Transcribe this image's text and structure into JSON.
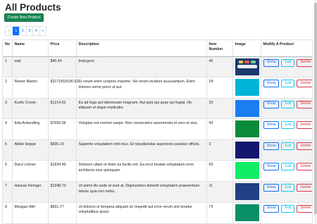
{
  "page": {
    "title": "All Products",
    "create_button": "Create New Product"
  },
  "pagination": {
    "prev": "«",
    "pages": [
      "1",
      "2",
      "3",
      "4"
    ],
    "active_page": "1",
    "next": "»"
  },
  "table": {
    "headers": [
      "No",
      "Name",
      "Price",
      "Description",
      "Item Number",
      "Image",
      "Modify A Product"
    ],
    "actions": {
      "show": "Show",
      "edit": "Edit",
      "delete": "Delete"
    },
    "rows": [
      {
        "no": "1",
        "name": "wali",
        "price": "$40.49",
        "description": "bndcgxvn",
        "item_number": "45",
        "image_color": "#1a3a6e"
      },
      {
        "no": "2",
        "name": "Renee Barton",
        "price": "$3171818196.53",
        "description": "Et rerum enim corporis maxime. Vel rerum incidunt accusantium. Enim dolores nemo porro ut aut.",
        "item_number": "24",
        "image_color": "#00b4d8"
      },
      {
        "no": "3",
        "name": "Kurtis Cronin",
        "price": "$1214.62",
        "description": "Ea ad fuga aut laboriosam magnam. Aut quia qui quae qui fugiat. Hic aliquam ut atque explicabo.",
        "item_number": "33",
        "image_color": "#1a7df0"
      },
      {
        "no": "4",
        "name": "Eda Ankunding",
        "price": "$7693.36",
        "description": "Voluptas est eveniet saepe. Non consectetur assumenda et vero et eius.",
        "item_number": "43",
        "image_color": "#0b8a3a"
      },
      {
        "no": "5",
        "name": "Abbie Hoppe",
        "price": "$835.19",
        "description": "Sapiente voluptatem nihil eius. Et repudiandae asperiores pariatur officiis.",
        "item_number": "2",
        "image_color": "#14176e"
      },
      {
        "no": "6",
        "name": "Daryl Lehner",
        "price": "$1834.49",
        "description": "Dolorem ullam et dolor ea facilis est. Ea error beatae voluptatum error architecto eius quisquam.",
        "item_number": "60",
        "image_color": "#11ee66"
      },
      {
        "no": "7",
        "name": "Hassan Reinger",
        "price": "$1948.73",
        "description": "Ut animi illo unde et sunt at. Dignissimos deleniti voluptatem praesentium labore quia non nobis.",
        "item_number": "11",
        "image_color": "#1f3f86"
      },
      {
        "no": "8",
        "name": "Meagan Will",
        "price": "$691.77",
        "description": "Ut dolores ut tempora aliquam id. Impedit aut error rerum sint tenetur voluptatibus quasi.",
        "item_number": "73",
        "image_color": "#0a8f66"
      }
    ]
  }
}
